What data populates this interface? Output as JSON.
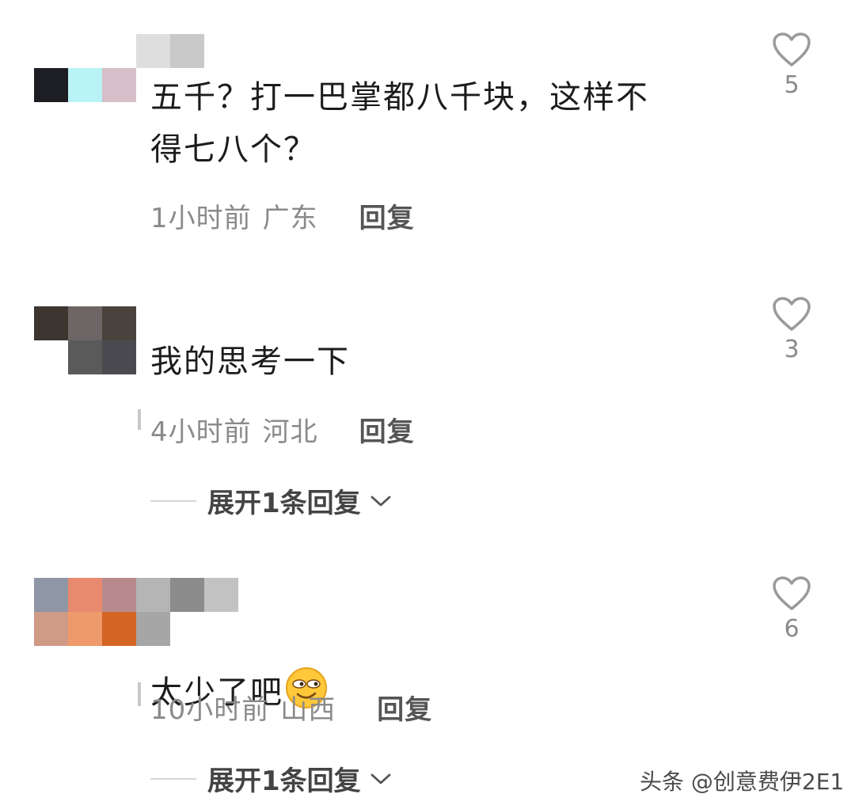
{
  "comments": [
    {
      "text": "五千？打一巴掌都八千块，这样不\n得七八个？",
      "time": "1小时前",
      "region": "广东",
      "reply_label": "回复",
      "likes": "5",
      "avatar_colors": [
        "#1d1d24",
        "#b9f3f6",
        "#d6bfc8"
      ],
      "name_colors": [
        "#dedede",
        "#c9c9c9"
      ]
    },
    {
      "text": "我的思考一下",
      "time": "4小时前",
      "region": "河北",
      "reply_label": "回复",
      "likes": "3",
      "expand_label": "展开1条回复",
      "avatar_colors": [
        "#3c3530",
        "#6e6666",
        "#4a433d",
        "#5a5a5a",
        "#4b4a50"
      ]
    },
    {
      "text": "太少了吧",
      "time": "10小时前",
      "region": "山西",
      "reply_label": "回复",
      "likes": "6",
      "expand_label": "展开1条回复",
      "avatar_colors": [
        "#8f96a6",
        "#e88a70",
        "#b88a8e",
        "#b5b5b5",
        "#8c8c8c",
        "#c2c2c2",
        "#cf9a86",
        "#ee9a6a",
        "#d46525",
        "#a6a6a6"
      ]
    }
  ],
  "watermark": "头条 @创意费伊2E1",
  "icons": {
    "like": "heart-outline-icon",
    "expand": "chevron-down-icon",
    "emoji": "smirk-face-emoji-icon"
  }
}
